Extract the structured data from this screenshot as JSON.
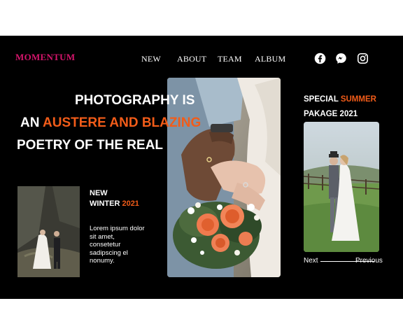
{
  "brand": {
    "logo_text": "MOMENTUM",
    "accent_color": "#f25c19",
    "logo_color": "#d6156c"
  },
  "nav": {
    "items": [
      {
        "label": "NEW"
      },
      {
        "label": "ABOUT"
      },
      {
        "label": "TEAM"
      },
      {
        "label": "ALBUM"
      }
    ]
  },
  "social": {
    "icons": [
      "facebook-icon",
      "messenger-icon",
      "instagram-icon"
    ]
  },
  "hero": {
    "line1": "PHOTOGRAPHY IS",
    "line2_plain": "AN ",
    "line2_accent": "AUSTERE AND BLAZING",
    "line3": "POETRY OF THE REAL"
  },
  "new_winter": {
    "line1": "NEW",
    "line2_plain": "WINTER ",
    "line2_accent": "2021",
    "body": "Lorem ipsum dolor sit amet, consetetur sadipscing el nonumy."
  },
  "special": {
    "line1_plain": "SPECIAL ",
    "line1_accent": "SUMMER",
    "line2": "PAKAGE 2021"
  },
  "pager": {
    "next_label": "Next",
    "previous_label": "Previous"
  }
}
